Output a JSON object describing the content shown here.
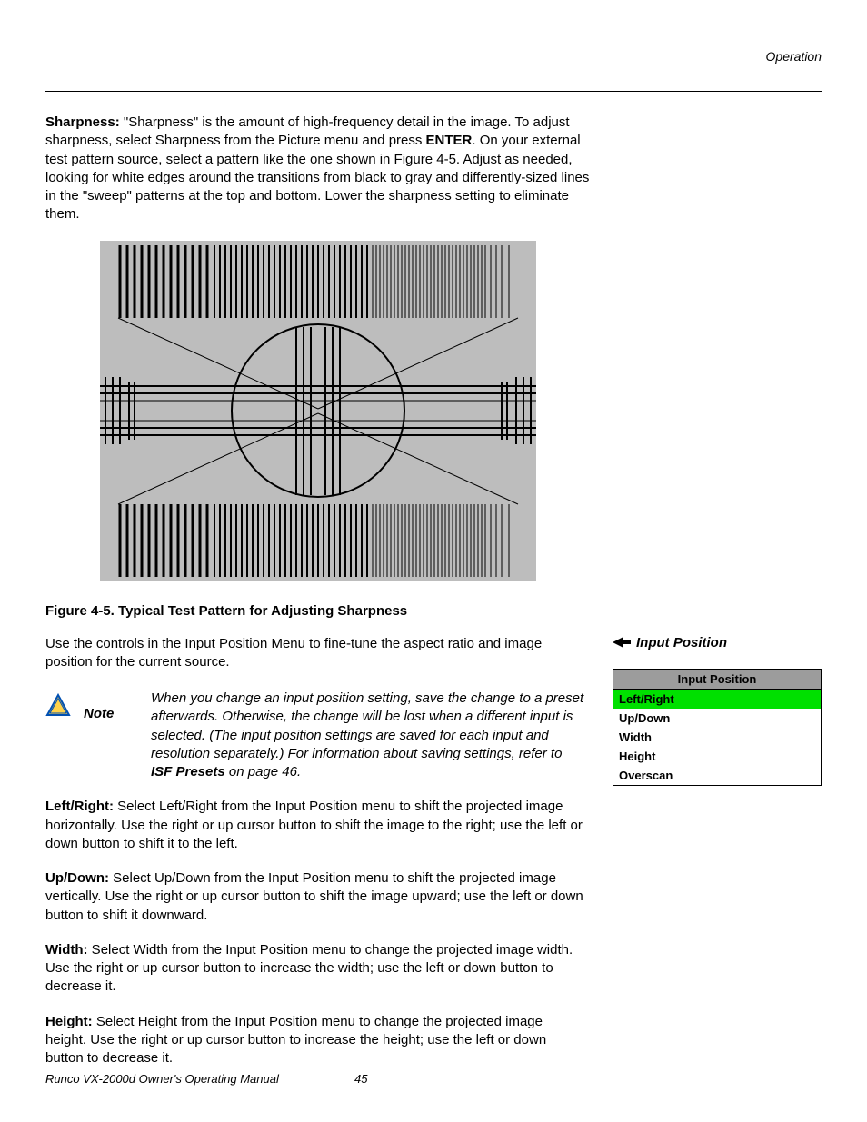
{
  "header": {
    "section": "Operation"
  },
  "sharpness": {
    "label": "Sharpness:",
    "text_a": " \"Sharpness\" is the amount of high-frequency detail in the image. To adjust sharpness, select Sharpness from the Picture menu and press ",
    "enter": "ENTER",
    "text_b": ". On your external test pattern source, select a pattern like the one shown in Figure 4-5. Adjust as needed, looking for white edges around the transitions from black to gray and differently-sized lines in the \"sweep\" patterns at the top and bottom. Lower the sharpness setting to eliminate them."
  },
  "figure": {
    "caption": "Figure 4-5. Typical Test Pattern for Adjusting Sharpness"
  },
  "input_position_intro": "Use the controls in the Input Position Menu to fine-tune the aspect ratio and image position for the current source.",
  "section_marker": "Input Position",
  "menu": {
    "title": "Input Position",
    "items": [
      "Left/Right",
      "Up/Down",
      "Width",
      "Height",
      "Overscan"
    ],
    "selected_index": 0
  },
  "note": {
    "label": "Note",
    "text_a": "When you change an input position setting, save the change to a preset afterwards. Otherwise, the change will be lost when a different input is selected. (The input position settings are saved for each input and resolution separately.) For information about saving settings, refer to ",
    "ref": "ISF Presets",
    "text_b": " on page 46."
  },
  "paras": {
    "leftright": {
      "label": "Left/Right:",
      "text": " Select Left/Right from the Input Position menu to shift the projected image horizontally. Use the right or up cursor button to shift the image to the right; use the left or down button to shift it to the left."
    },
    "updown": {
      "label": "Up/Down:",
      "text": " Select Up/Down from the Input Position menu to shift the projected image vertically. Use the right or up cursor button to shift the image upward; use the left or down button to shift it downward."
    },
    "width": {
      "label": "Width:",
      "text": " Select Width from the Input Position menu to change the projected image width. Use the right or up cursor button to increase the width; use the left or down button to decrease it."
    },
    "height": {
      "label": "Height:",
      "text": " Select Height from the Input Position menu to change the projected image height. Use the right or up cursor button to increase the height; use the left or down button to decrease it."
    }
  },
  "footer": {
    "title": "Runco VX-2000d Owner's Operating Manual",
    "page": "45"
  }
}
